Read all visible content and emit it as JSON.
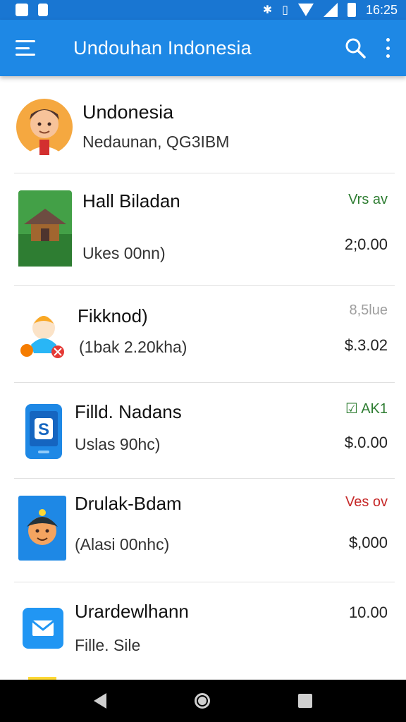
{
  "status_bar": {
    "time": "16:25"
  },
  "app_bar": {
    "title": "Undouhan Indonesia"
  },
  "profile": {
    "name": "Undonesia",
    "detail": "Nedaunan, QG3IBM"
  },
  "items": [
    {
      "title": "Hall Biladan",
      "subtitle": "Ukes 00nn)",
      "tag": "Vrs av",
      "tag_color": "#2e7d32",
      "price": "2;0.00"
    },
    {
      "title": "Fikknod)",
      "subtitle": "(1bak 2.20kha)",
      "tag": "8,5lue",
      "tag_color": "#9e9e9e",
      "price": "$.3.02"
    },
    {
      "title": "Filld. Nadans",
      "subtitle": "Uslas 90hc)",
      "tag": "☑ AK1",
      "tag_color": "#2e7d32",
      "price": "$.0.00"
    },
    {
      "title": "Drulak-Bdam",
      "subtitle": "(Alasi 00nhc)",
      "tag": "Ves ov",
      "tag_color": "#c62828",
      "price": "$,000"
    },
    {
      "title": "Urardewlhann",
      "subtitle": "Fille. Sile",
      "tag": "",
      "tag_color": "#000000",
      "price": "10.00"
    }
  ],
  "icons": {
    "menu": "menu-icon",
    "search": "search-icon",
    "more": "more-vert-icon",
    "nav_back": "back-icon",
    "nav_home": "home-icon",
    "nav_recent": "recent-apps-icon"
  },
  "colors": {
    "primary": "#1e88e5",
    "status": "#1976d2"
  }
}
